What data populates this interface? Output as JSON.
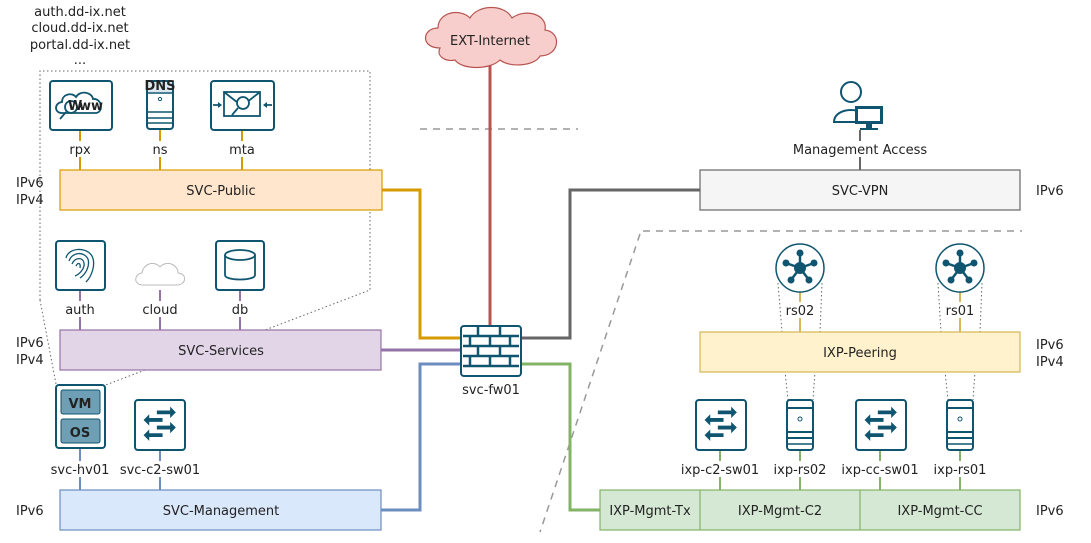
{
  "domains": [
    "auth.dd-ix.net",
    "cloud.dd-ix.net",
    "portal.dd-ix.net",
    "..."
  ],
  "internet": {
    "label": "EXT-Internet",
    "color": "#f8cecc"
  },
  "firewall": {
    "label": "svc-fw01",
    "icon": "firewall-icon"
  },
  "networks": {
    "svc_public": {
      "label": "SVC-Public",
      "protocols": [
        "IPv6",
        "IPv4"
      ],
      "color": "#ffe6cc"
    },
    "svc_services": {
      "label": "SVC-Services",
      "protocols": [
        "IPv6",
        "IPv4"
      ],
      "color": "#e1d5e7"
    },
    "svc_management": {
      "label": "SVC-Management",
      "protocols": [
        "IPv6"
      ],
      "color": "#dae8fc"
    },
    "svc_vpn": {
      "label": "SVC-VPN",
      "protocols": [
        "IPv6"
      ],
      "color": "#f5f5f5"
    },
    "ixp_peering": {
      "label": "IXP-Peering",
      "protocols": [
        "IPv6",
        "IPv4"
      ],
      "color": "#fff2cc"
    },
    "ixp_mgmt": {
      "segments": [
        "IXP-Mgmt-Tx",
        "IXP-Mgmt-C2",
        "IXP-Mgmt-CC"
      ],
      "protocols": [
        "IPv6"
      ],
      "color": "#d5e8d4"
    }
  },
  "public_hosts": [
    {
      "label": "rpx",
      "icon": "www-icon"
    },
    {
      "label": "ns",
      "icon": "dns-server-icon"
    },
    {
      "label": "mta",
      "icon": "mail-icon"
    }
  ],
  "service_hosts": [
    {
      "label": "auth",
      "icon": "fingerprint-icon"
    },
    {
      "label": "cloud",
      "icon": "cloud-icon"
    },
    {
      "label": "db",
      "icon": "database-icon"
    }
  ],
  "mgmt_hosts": [
    {
      "label": "svc-hv01",
      "icon": "vm-os-icon"
    },
    {
      "label": "svc-c2-sw01",
      "icon": "switch-icon"
    }
  ],
  "management_access": {
    "label": "Management Access",
    "icon": "user-workstation-icon"
  },
  "route_servers": [
    {
      "label": "rs02",
      "icon": "router-hub-icon"
    },
    {
      "label": "rs01",
      "icon": "router-hub-icon"
    }
  ],
  "ixp_hosts": [
    {
      "label": "ixp-c2-sw01",
      "icon": "switch-icon"
    },
    {
      "label": "ixp-rs02",
      "icon": "server-icon"
    },
    {
      "label": "ixp-cc-sw01",
      "icon": "switch-icon"
    },
    {
      "label": "ixp-rs01",
      "icon": "server-icon"
    }
  ],
  "link_colors": {
    "internet": "#b85450",
    "public": "#d79b00",
    "services": "#9673a6",
    "management": "#6c8ebf",
    "vpn": "#666666",
    "ixp": "#82b366"
  }
}
